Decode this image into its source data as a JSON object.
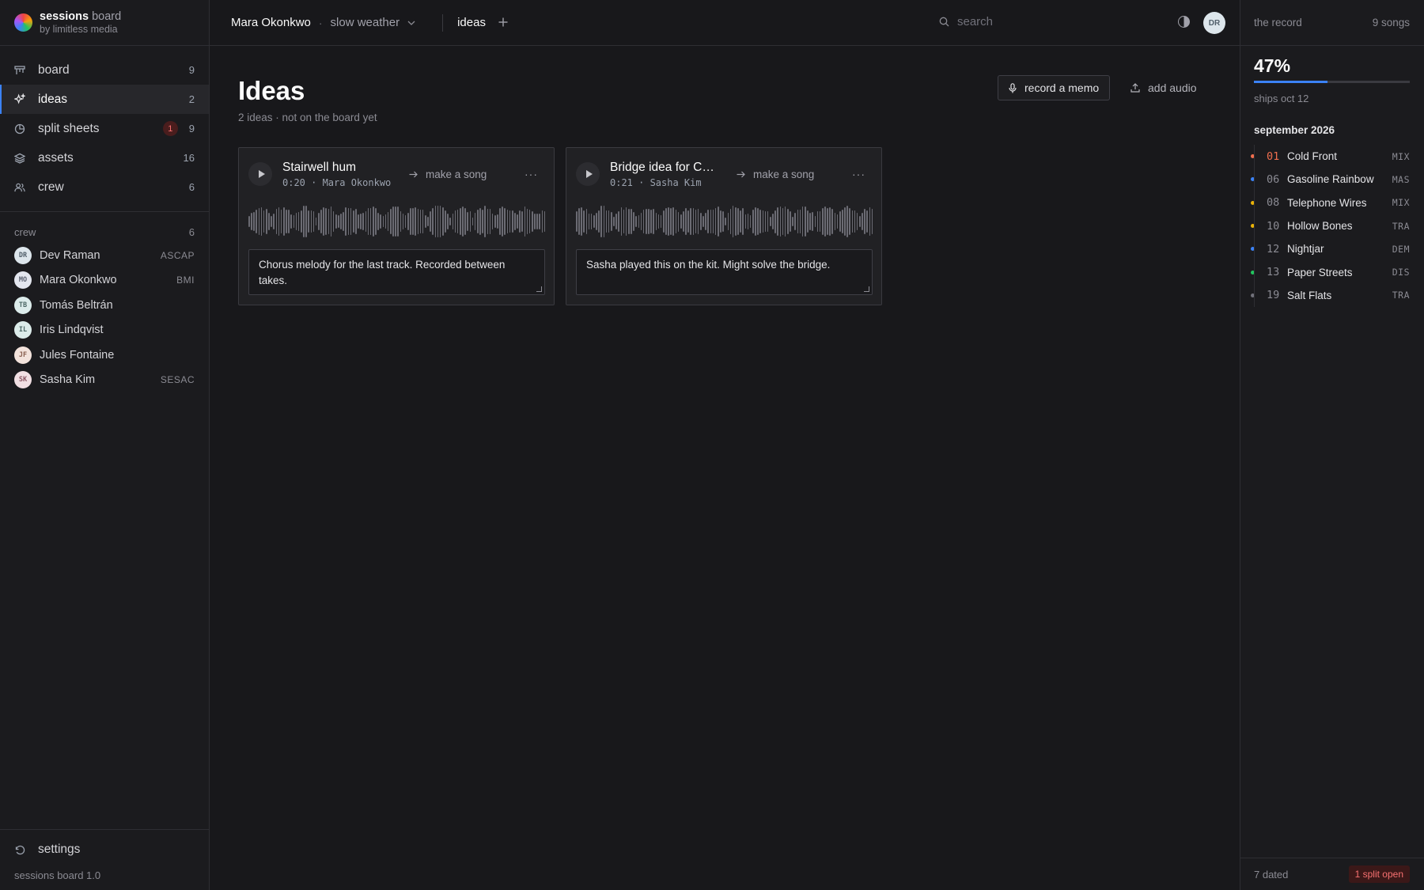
{
  "brand": {
    "name": "sessions",
    "name_suffix": "board",
    "sub": "by limitless media"
  },
  "nav": [
    {
      "label": "board",
      "count": "9",
      "icon": "board-icon"
    },
    {
      "label": "ideas",
      "count": "2",
      "icon": "sparkle-icon",
      "active": true
    },
    {
      "label": "split sheets",
      "count": "9",
      "badge": "1",
      "icon": "pie-chart-icon"
    },
    {
      "label": "assets",
      "count": "16",
      "icon": "layers-icon"
    },
    {
      "label": "crew",
      "count": "6",
      "icon": "users-icon"
    }
  ],
  "crew": {
    "heading": "crew",
    "count": "6",
    "members": [
      {
        "initials": "DR",
        "name": "Dev Raman",
        "pro": "ASCAP",
        "color": "#dde6ec"
      },
      {
        "initials": "MO",
        "name": "Mara Okonkwo",
        "pro": "BMI",
        "color": "#e3e6ee"
      },
      {
        "initials": "TB",
        "name": "Tomás Beltrán",
        "pro": "",
        "color": "#dceceb"
      },
      {
        "initials": "IL",
        "name": "Iris Lindqvist",
        "pro": "",
        "color": "#dcecea"
      },
      {
        "initials": "JF",
        "name": "Jules Fontaine",
        "pro": "",
        "color": "#f3e3dc"
      },
      {
        "initials": "SK",
        "name": "Sasha Kim",
        "pro": "SESAC",
        "color": "#f1dfe3"
      }
    ]
  },
  "footer": {
    "settings": "settings",
    "version": "sessions board 1.0"
  },
  "topbar": {
    "artist": "Mara Okonkwo",
    "sep": "·",
    "album": "slow weather",
    "tab": "ideas",
    "search_placeholder": "search",
    "user_initials": "DR"
  },
  "page": {
    "title": "Ideas",
    "subtitle": "2 ideas · not on the board yet",
    "record_button": "record a memo",
    "add_audio": "add audio"
  },
  "ideas": [
    {
      "title": "Stairwell hum",
      "info": "0:20 · Mara Okonkwo",
      "action": "make a song",
      "note": "Chorus melody for the last track. Recorded between takes."
    },
    {
      "title": "Bridge idea for Cold Front",
      "info": "0:21 · Sasha Kim",
      "action": "make a song",
      "note": "Sasha played this on the kit. Might solve the bridge."
    }
  ],
  "record": {
    "heading": "the record",
    "songs": "9 songs",
    "percent": "47%",
    "progress": 0.47,
    "ships": "ships oct 12",
    "month": "september 2026",
    "tracks": [
      {
        "num": "01",
        "name": "Cold Front",
        "stage": "MIX",
        "color": "#ef6e4e"
      },
      {
        "num": "06",
        "name": "Gasoline Rainbow",
        "stage": "MAS",
        "color": "#3b82f6"
      },
      {
        "num": "08",
        "name": "Telephone Wires",
        "stage": "MIX",
        "color": "#eab308"
      },
      {
        "num": "10",
        "name": "Hollow Bones",
        "stage": "TRA",
        "color": "#eab308"
      },
      {
        "num": "12",
        "name": "Nightjar",
        "stage": "DEM",
        "color": "#3b82f6"
      },
      {
        "num": "13",
        "name": "Paper Streets",
        "stage": "DIS",
        "color": "#22c55e"
      },
      {
        "num": "19",
        "name": "Salt Flats",
        "stage": "TRA",
        "color": "#71717a"
      }
    ],
    "dated": "7 dated",
    "split_open": "1 split open"
  },
  "colors": {
    "accent": "#3b82f6",
    "background": "#18181b",
    "alert": "#f87171"
  }
}
